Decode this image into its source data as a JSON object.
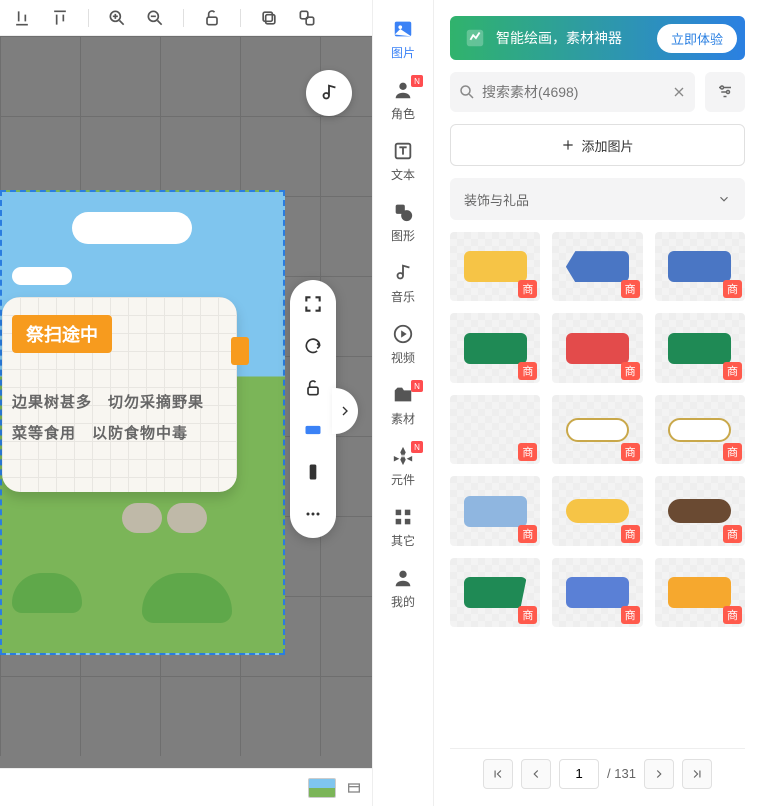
{
  "toolbar": {
    "icons": [
      "align-bottom",
      "align-top",
      "zoom-in",
      "zoom-out",
      "unlock",
      "copy",
      "duplicate"
    ]
  },
  "stage": {
    "badge": "祭扫途中",
    "line1": "边果树甚多　切勿采摘野果",
    "line2": "菜等食用　以防食物中毒"
  },
  "float_tools": [
    "fullscreen",
    "rotate",
    "unlock",
    "device-landscape",
    "device-portrait",
    "more"
  ],
  "categories": [
    {
      "id": "image",
      "label": "图片",
      "badge": false,
      "active": true
    },
    {
      "id": "role",
      "label": "角色",
      "badge": true,
      "active": false
    },
    {
      "id": "text",
      "label": "文本",
      "badge": false,
      "active": false
    },
    {
      "id": "shape",
      "label": "图形",
      "badge": false,
      "active": false
    },
    {
      "id": "music",
      "label": "音乐",
      "badge": false,
      "active": false
    },
    {
      "id": "video",
      "label": "视频",
      "badge": false,
      "active": false
    },
    {
      "id": "assets",
      "label": "素材",
      "badge": true,
      "active": false
    },
    {
      "id": "component",
      "label": "元件",
      "badge": true,
      "active": false
    },
    {
      "id": "other",
      "label": "其它",
      "badge": false,
      "active": false
    },
    {
      "id": "mine",
      "label": "我的",
      "badge": false,
      "active": false
    }
  ],
  "banner": {
    "text": "智能绘画，素材神器",
    "cta": "立即体验"
  },
  "search": {
    "placeholder": "搜索素材(4698)"
  },
  "add_button": "添加图片",
  "dropdown": {
    "selected": "装饰与礼品"
  },
  "asset_tag": "商",
  "assets": [
    {
      "color": "#f6c446",
      "shape": "rect"
    },
    {
      "color": "#4a76c4",
      "shape": "arrow"
    },
    {
      "color": "#4a76c4",
      "shape": "rect"
    },
    {
      "color": "#1f8a55",
      "shape": "rect"
    },
    {
      "color": "#e34b4b",
      "shape": "rect"
    },
    {
      "color": "#1f8a55",
      "shape": "rect"
    },
    {
      "color": "transparent",
      "shape": "empty"
    },
    {
      "color": "#ffffff",
      "shape": "pill-o"
    },
    {
      "color": "#ffffff",
      "shape": "pill-o"
    },
    {
      "color": "#8fb6e0",
      "shape": "rect"
    },
    {
      "color": "#f6c446",
      "shape": "pill"
    },
    {
      "color": "#6a4a32",
      "shape": "pill"
    },
    {
      "color": "#1f8a55",
      "shape": "slant"
    },
    {
      "color": "#5a80d6",
      "shape": "rect"
    },
    {
      "color": "#f6a82e",
      "shape": "rect"
    }
  ],
  "pagination": {
    "current": "1",
    "total": "/ 131"
  }
}
